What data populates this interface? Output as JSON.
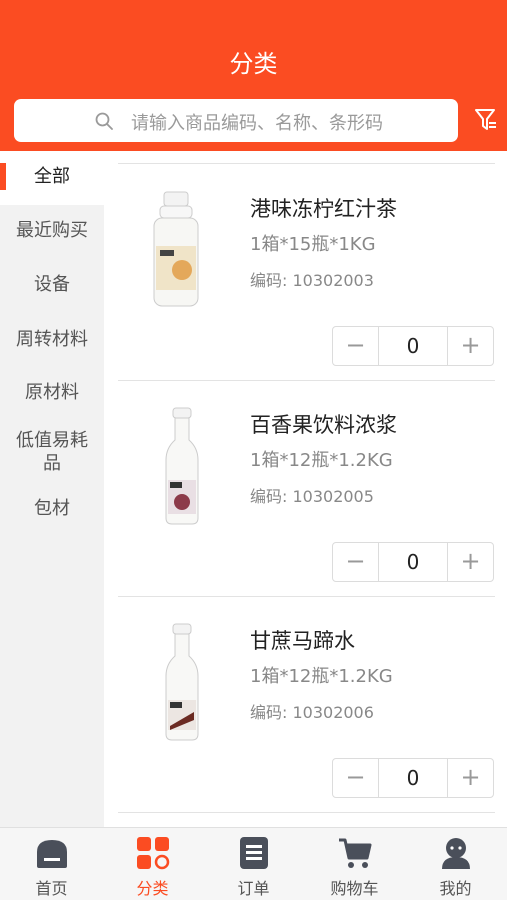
{
  "header": {
    "title": "分类",
    "search_placeholder": "请输入商品编码、名称、条形码",
    "brand_color": "#fb4c22"
  },
  "sidebar": {
    "items": [
      {
        "label": "全部",
        "active": true
      },
      {
        "label": "最近购买"
      },
      {
        "label": "设备"
      },
      {
        "label": "周转材料"
      },
      {
        "label": "原材料"
      },
      {
        "label": "低值易耗品"
      },
      {
        "label": "包材"
      }
    ]
  },
  "products": [
    {
      "name": "港味冻柠红汁茶",
      "spec": "1箱*15瓶*1KG",
      "code": "编码: 10302003",
      "qty": "0",
      "minus": "−",
      "plus": "+"
    },
    {
      "name": "百香果饮料浓浆",
      "spec": "1箱*12瓶*1.2KG",
      "code": "编码: 10302005",
      "qty": "0",
      "minus": "−",
      "plus": "+"
    },
    {
      "name": "甘蔗马蹄水",
      "spec": "1箱*12瓶*1.2KG",
      "code": "编码: 10302006",
      "qty": "0",
      "minus": "−",
      "plus": "+"
    }
  ],
  "tabbar": {
    "items": [
      {
        "label": "首页",
        "icon": "home-icon"
      },
      {
        "label": "分类",
        "icon": "category-icon",
        "active": true
      },
      {
        "label": "订单",
        "icon": "order-icon"
      },
      {
        "label": "购物车",
        "icon": "cart-icon"
      },
      {
        "label": "我的",
        "icon": "profile-icon"
      }
    ]
  }
}
